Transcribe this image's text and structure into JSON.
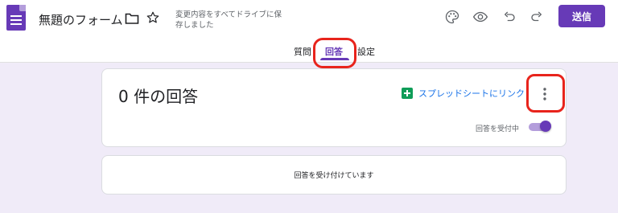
{
  "header": {
    "form_title": "無題のフォーム",
    "save_status": "変更内容をすべてドライブに保存しました",
    "send_label": "送信",
    "icons": [
      "forms-logo",
      "folder-icon",
      "star-icon",
      "palette-icon",
      "eye-icon",
      "undo-icon",
      "redo-icon"
    ]
  },
  "tabs": [
    {
      "label": "質問"
    },
    {
      "label": "回答",
      "selected": true
    },
    {
      "label": "設定"
    }
  ],
  "responses": {
    "count_label": "0 件の回答",
    "sheet_link_label": "スプレッドシートにリンク",
    "accepting_label": "回答を受付中",
    "accepting": true,
    "status_message": "回答を受け付けています"
  },
  "colors": {
    "accent": "#673ab7",
    "background": "#f0ebf8",
    "link": "#1a73e8",
    "sheets_green": "#0f9d58",
    "annotation_red": "#e8241c"
  }
}
